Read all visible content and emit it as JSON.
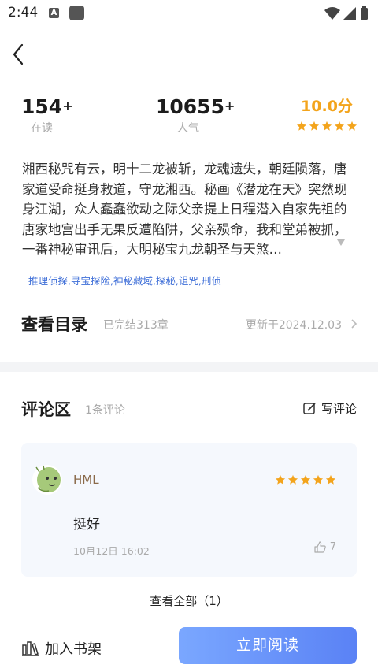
{
  "status_bar": {
    "time": "2:44",
    "app_icon_letter": "A"
  },
  "stats": [
    {
      "value": "154",
      "suffix": "+",
      "label": "在读"
    },
    {
      "value": "10655",
      "suffix": "+",
      "label": "人气"
    }
  ],
  "score": {
    "value": "10.0分",
    "stars": 5,
    "color": "#f3a41c"
  },
  "description": "湘西秘咒有云，明十二龙被斩，龙魂遗失，朝廷陨落，唐家道受命挺身救道，守龙湘西。秘画《潜龙在天》突然现身江湖，众人蠢蠢欲动之际父亲提上日程潜入自家先祖的唐家地宫出手无果反遭陷阱，父亲殒命，我和堂弟被抓，一番神秘审讯后，大明秘宝九龙朝圣与天煞…",
  "tags": "推理侦探,寻宝探险,神秘藏域,探秘,诅咒,刑侦",
  "catalog": {
    "title": "查看目录",
    "status": "已完结313章",
    "updated": "更新于2024.12.03"
  },
  "comments": {
    "title": "评论区",
    "count": "1条评论",
    "write_label": "写评论",
    "items": [
      {
        "user": "HML",
        "stars": 5,
        "text": "挺好",
        "date": "10月12日 16:02",
        "likes": "7"
      }
    ],
    "view_all": "查看全部（1）"
  },
  "bottom": {
    "shelf_label": "加入书架",
    "read_label": "立即阅读"
  },
  "colors": {
    "accent": "#5a82f5",
    "star": "#f3a41c",
    "tag": "#3f6fd8"
  }
}
